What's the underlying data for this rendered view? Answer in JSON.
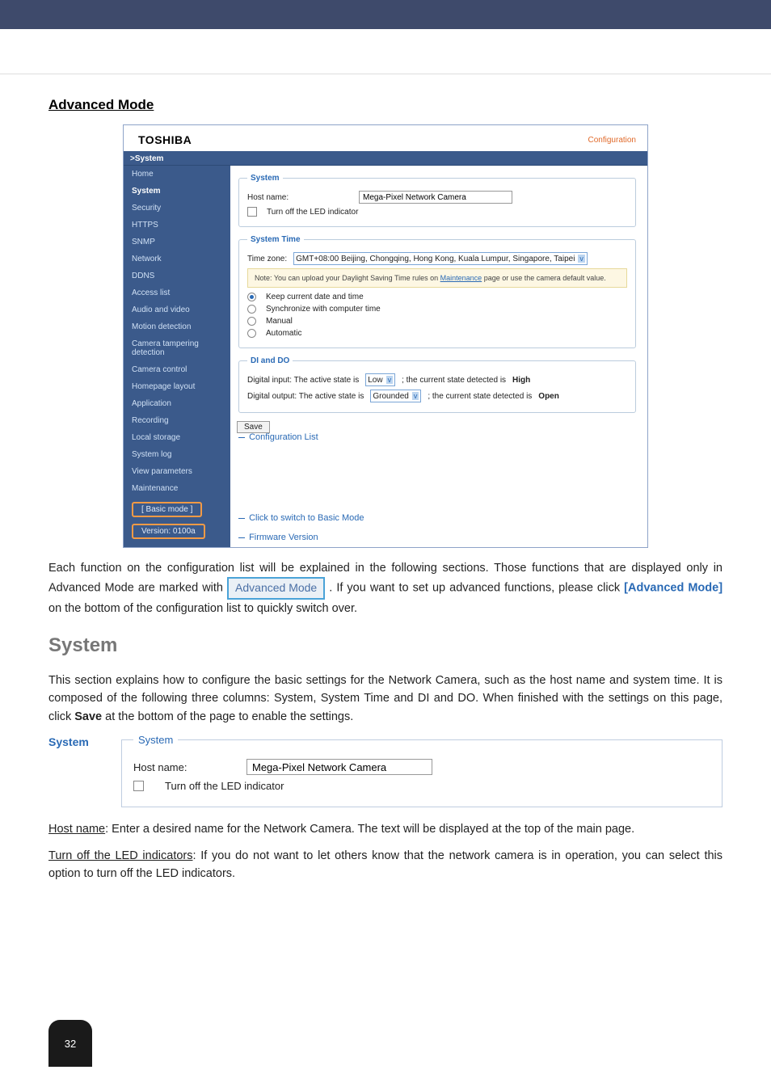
{
  "heading_advanced": "Advanced Mode",
  "screenshot": {
    "brand": "TOSHIBA",
    "configuration_link": "Configuration",
    "breadcrumb": ">System",
    "nav": [
      "Home",
      "System",
      "Security",
      "HTTPS",
      "SNMP",
      "Network",
      "DDNS",
      "Access list",
      "Audio and video",
      "Motion detection",
      "Camera tampering detection",
      "Camera control",
      "Homepage layout",
      "Application",
      "Recording",
      "Local storage",
      "System log",
      "View parameters",
      "Maintenance"
    ],
    "basic_mode_pill": "[ Basic mode ]",
    "version_pill": "Version: 0100a",
    "system_panel": {
      "legend": "System",
      "hostname_label": "Host name:",
      "hostname_value": "Mega-Pixel Network Camera",
      "led_label": "Turn off the LED indicator"
    },
    "system_time": {
      "legend": "System Time",
      "tz_label": "Time zone:",
      "tz_value": "GMT+08:00 Beijing, Chongqing, Hong Kong, Kuala Lumpur, Singapore, Taipei",
      "note_before": "Note: You can upload your Daylight Saving Time rules on ",
      "note_link": "Maintenance",
      "note_after": " page or use the camera default value.",
      "opt_keep": "Keep current date and time",
      "opt_sync": "Synchronize with computer time",
      "opt_manual": "Manual",
      "opt_auto": "Automatic"
    },
    "dido": {
      "legend": "DI and DO",
      "di_before": "Digital input: The active state is ",
      "di_sel": "Low",
      "di_after": " ; the current state detected is ",
      "di_state": "High",
      "do_before": "Digital output: The active state is ",
      "do_sel": "Grounded",
      "do_after": " ; the current state detected is ",
      "do_state": "Open"
    },
    "save_btn": "Save",
    "callouts": {
      "conf_list": "Configuration List",
      "basic": "Click to switch to Basic Mode",
      "fw": "Firmware Version"
    }
  },
  "para1_a": "Each function on the configuration list will be explained in the following sections. Those functions that are displayed only in Advanced Mode are marked with ",
  "para1_chip": "Advanced Mode",
  "para1_b": ". If you want to set up advanced functions, please click ",
  "para1_link": "[Advanced Mode]",
  "para1_c": " on the bottom of the configuration list to quickly switch over.",
  "system_heading": "System",
  "para2": "This section explains how to configure the basic settings for the Network Camera, such as the host name and system time. It is composed of the following three columns: System, System Time and DI and DO. When finished with the settings on this page, click Save at the bottom of the page to enable the settings.",
  "para2_bold_word": "Save",
  "system_subhead": "System",
  "doc_fs": {
    "legend": "System",
    "hostname_label": "Host name:",
    "hostname_value": "Mega-Pixel Network Camera",
    "led_label": "Turn off the LED indicator"
  },
  "para3_a_term": "Host name",
  "para3_a": ": Enter a desired name for the Network Camera. The text will be displayed at the top of the main page.",
  "para4_a_term": "Turn off the LED indicators",
  "para4_a": ": If you do not want to let others know that the network camera is in operation, you can select this option to turn off the LED indicators.",
  "page_number": "32"
}
